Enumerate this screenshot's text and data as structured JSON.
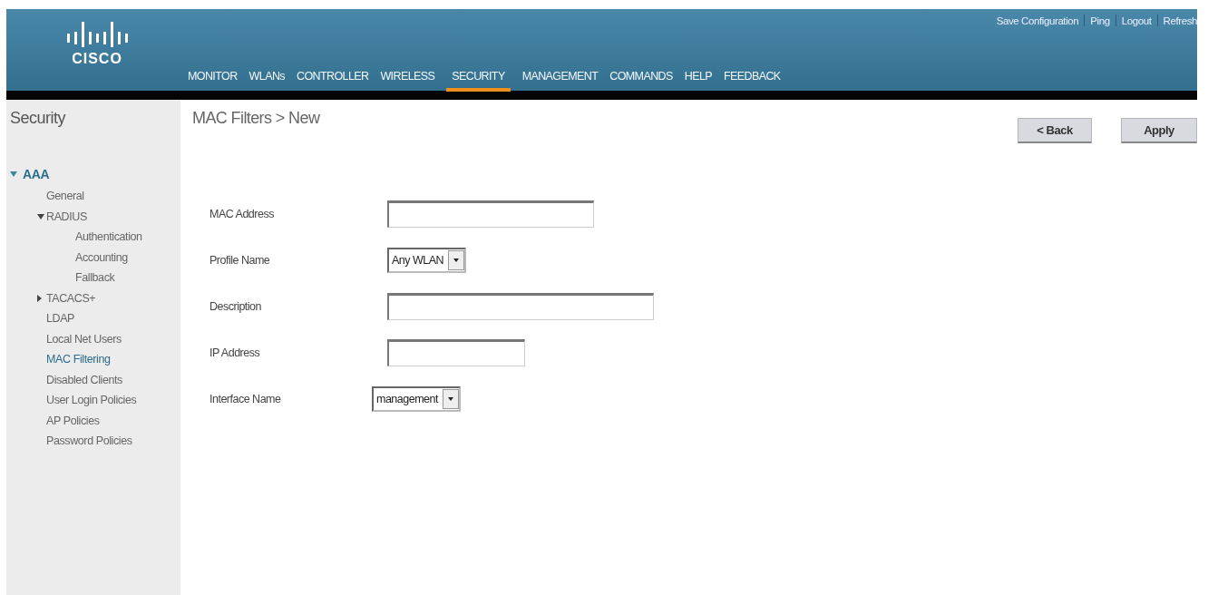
{
  "header": {
    "logo": "CISCO",
    "top_links": [
      "Save Configuration",
      "Ping",
      "Logout",
      "Refresh"
    ],
    "nav": [
      {
        "label": "MONITOR",
        "selected": false
      },
      {
        "label": "WLANs",
        "selected": false
      },
      {
        "label": "CONTROLLER",
        "selected": false
      },
      {
        "label": "WIRELESS",
        "selected": false
      },
      {
        "label": "SECURITY",
        "selected": true
      },
      {
        "label": "MANAGEMENT",
        "selected": false
      },
      {
        "label": "COMMANDS",
        "selected": false
      },
      {
        "label": "HELP",
        "selected": false
      },
      {
        "label": "FEEDBACK",
        "selected": false
      }
    ]
  },
  "sidebar": {
    "title": "Security",
    "items": [
      {
        "label": "AAA",
        "expanded": true,
        "selected": false,
        "children": [
          {
            "label": "General",
            "selected": false
          },
          {
            "label": "RADIUS",
            "expanded": true,
            "selected": false,
            "children": [
              {
                "label": "Authentication",
                "selected": false
              },
              {
                "label": "Accounting",
                "selected": false
              },
              {
                "label": "Fallback",
                "selected": false
              }
            ]
          },
          {
            "label": "TACACS+",
            "expanded": false,
            "selected": false
          },
          {
            "label": "LDAP",
            "selected": false
          },
          {
            "label": "Local Net Users",
            "selected": false
          },
          {
            "label": "MAC Filtering",
            "selected": true
          },
          {
            "label": "Disabled Clients",
            "selected": false
          },
          {
            "label": "User Login Policies",
            "selected": false
          },
          {
            "label": "AP Policies",
            "selected": false
          },
          {
            "label": "Password Policies",
            "selected": false
          }
        ]
      }
    ]
  },
  "page": {
    "breadcrumb": "MAC Filters > New",
    "buttons": [
      "< Back",
      "Apply"
    ],
    "fields": [
      {
        "label": "MAC Address",
        "kind": "text"
      },
      {
        "label": "Profile Name",
        "kind": "select",
        "value": "Any WLAN"
      },
      {
        "label": "Description",
        "kind": "text"
      },
      {
        "label": "IP Address",
        "kind": "text"
      },
      {
        "label": "Interface Name",
        "kind": "select",
        "value": "management"
      }
    ]
  }
}
